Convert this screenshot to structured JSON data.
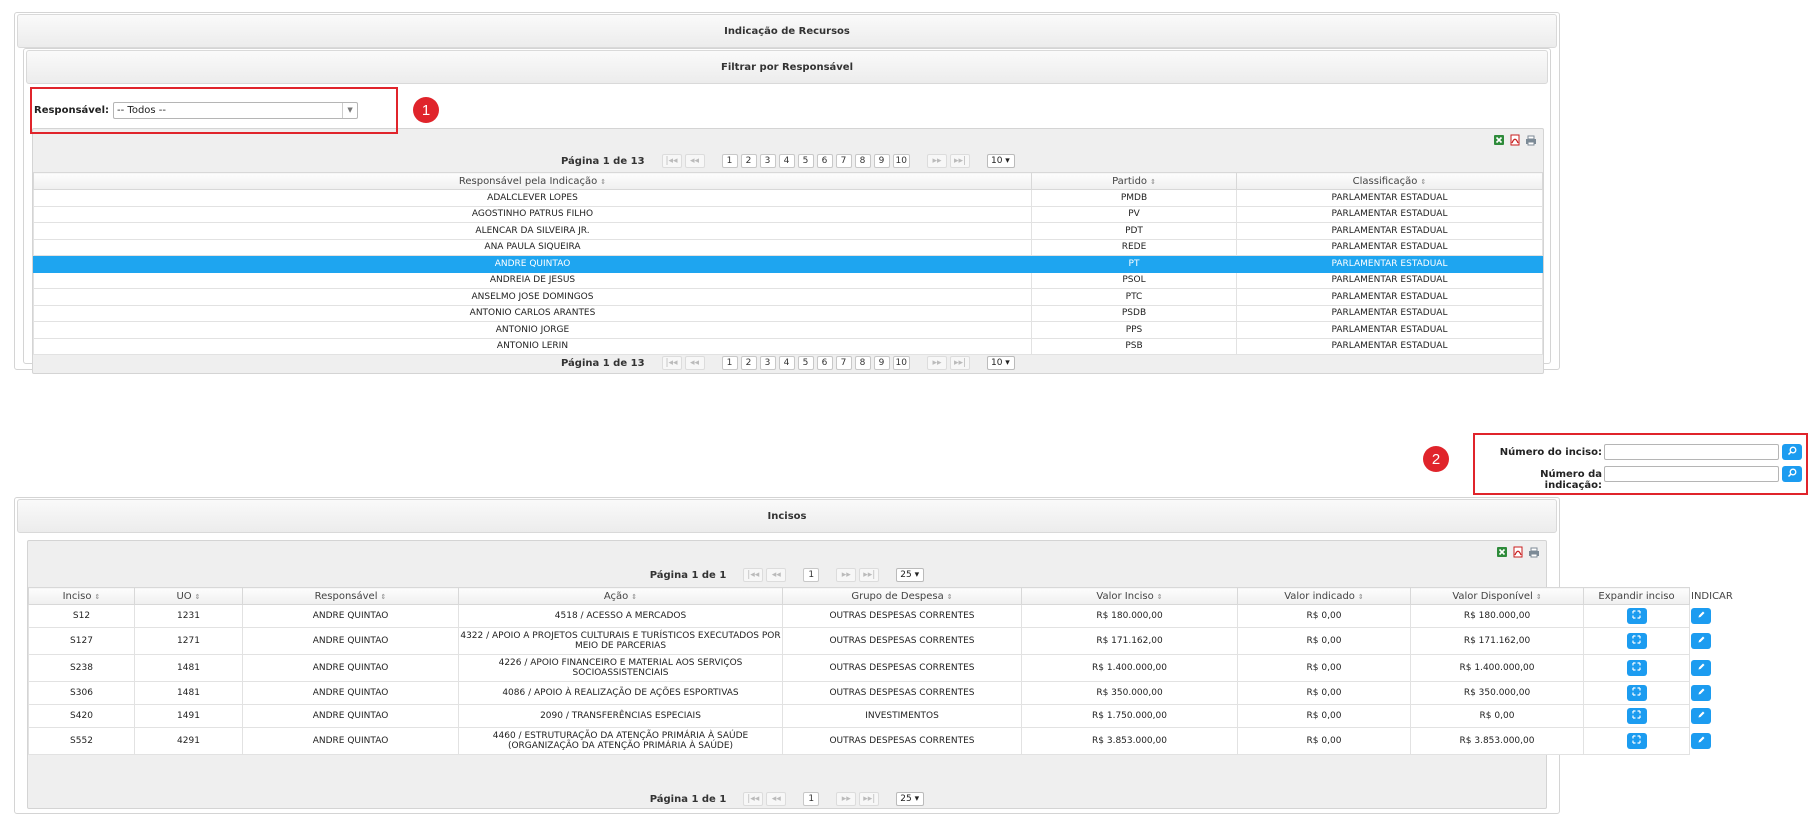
{
  "main_panel": {
    "title": "Indicação de Recursos"
  },
  "filter_panel": {
    "title": "Filtrar por Responsável",
    "responsavel_label": "Responsável:",
    "responsavel_value": "-- Todos --"
  },
  "annotations": {
    "marker1": "1",
    "marker2": "2"
  },
  "responsaveis_grid": {
    "pager_info": "Página 1 de 13",
    "pages": [
      "1",
      "2",
      "3",
      "4",
      "5",
      "6",
      "7",
      "8",
      "9",
      "10"
    ],
    "page_size": "10",
    "columns": [
      "Responsável pela Indicação",
      "Partido",
      "Classificação"
    ],
    "rows": [
      [
        "ADALCLEVER LOPES",
        "PMDB",
        "PARLAMENTAR ESTADUAL"
      ],
      [
        "AGOSTINHO PATRUS FILHO",
        "PV",
        "PARLAMENTAR ESTADUAL"
      ],
      [
        "ALENCAR DA SILVEIRA JR.",
        "PDT",
        "PARLAMENTAR ESTADUAL"
      ],
      [
        "ANA PAULA SIQUEIRA",
        "REDE",
        "PARLAMENTAR ESTADUAL"
      ],
      [
        "ANDRE QUINTAO",
        "PT",
        "PARLAMENTAR ESTADUAL"
      ],
      [
        "ANDREIA DE JESUS",
        "PSOL",
        "PARLAMENTAR ESTADUAL"
      ],
      [
        "ANSELMO JOSE DOMINGOS",
        "PTC",
        "PARLAMENTAR ESTADUAL"
      ],
      [
        "ANTONIO CARLOS ARANTES",
        "PSDB",
        "PARLAMENTAR ESTADUAL"
      ],
      [
        "ANTONIO JORGE",
        "PPS",
        "PARLAMENTAR ESTADUAL"
      ],
      [
        "ANTONIO LERIN",
        "PSB",
        "PARLAMENTAR ESTADUAL"
      ]
    ],
    "selected_row": 4
  },
  "search": {
    "inciso_label": "Número do inciso:",
    "inciso_value": "",
    "indicacao_label": "Número da indicação:",
    "indicacao_value": ""
  },
  "incisos_panel": {
    "title": "Incisos",
    "pager_info": "Página 1 de 1",
    "pages": [
      "1"
    ],
    "page_size": "25",
    "columns": [
      "Inciso",
      "UO",
      "Responsável",
      "Ação",
      "Grupo de Despesa",
      "Valor Inciso",
      "Valor indicado",
      "Valor Disponível",
      "Expandir inciso",
      "INDICAR"
    ],
    "rows": [
      [
        "S12",
        "1231",
        "ANDRE QUINTAO",
        "4518 / ACESSO A MERCADOS",
        "OUTRAS DESPESAS CORRENTES",
        "R$ 180.000,00",
        "R$ 0,00",
        "R$ 180.000,00"
      ],
      [
        "S127",
        "1271",
        "ANDRE QUINTAO",
        "4322 / APOIO A PROJETOS CULTURAIS E TURÍSTICOS EXECUTADOS POR MEIO DE PARCERIAS",
        "OUTRAS DESPESAS CORRENTES",
        "R$ 171.162,00",
        "R$ 0,00",
        "R$ 171.162,00"
      ],
      [
        "S238",
        "1481",
        "ANDRE QUINTAO",
        "4226 / APOIO FINANCEIRO E MATERIAL AOS SERVIÇOS SOCIOASSISTENCIAIS",
        "OUTRAS DESPESAS CORRENTES",
        "R$ 1.400.000,00",
        "R$ 0,00",
        "R$ 1.400.000,00"
      ],
      [
        "S306",
        "1481",
        "ANDRE QUINTAO",
        "4086 / APOIO À REALIZAÇÃO DE AÇÕES ESPORTIVAS",
        "OUTRAS DESPESAS CORRENTES",
        "R$ 350.000,00",
        "R$ 0,00",
        "R$ 350.000,00"
      ],
      [
        "S420",
        "1491",
        "ANDRE QUINTAO",
        "2090 / TRANSFERÊNCIAS ESPECIAIS",
        "INVESTIMENTOS",
        "R$ 1.750.000,00",
        "R$ 0,00",
        "R$ 0,00"
      ],
      [
        "S552",
        "4291",
        "ANDRE QUINTAO",
        "4460 / ESTRUTURAÇÃO DA ATENÇÃO PRIMÁRIA À SAÚDE (ORGANIZAÇÃO DA ATENÇÃO PRIMÁRIA À SAÚDE)",
        "OUTRAS DESPESAS CORRENTES",
        "R$ 3.853.000,00",
        "R$ 0,00",
        "R$ 3.853.000,00"
      ]
    ]
  },
  "colors": {
    "accent": "#1c9cf0",
    "selected_row": "#1ea5f0",
    "annotation_red": "#e0242b"
  },
  "icons": [
    "excel-icon",
    "pdf-icon",
    "print-icon",
    "expand-icon",
    "edit-icon",
    "search-icon"
  ]
}
